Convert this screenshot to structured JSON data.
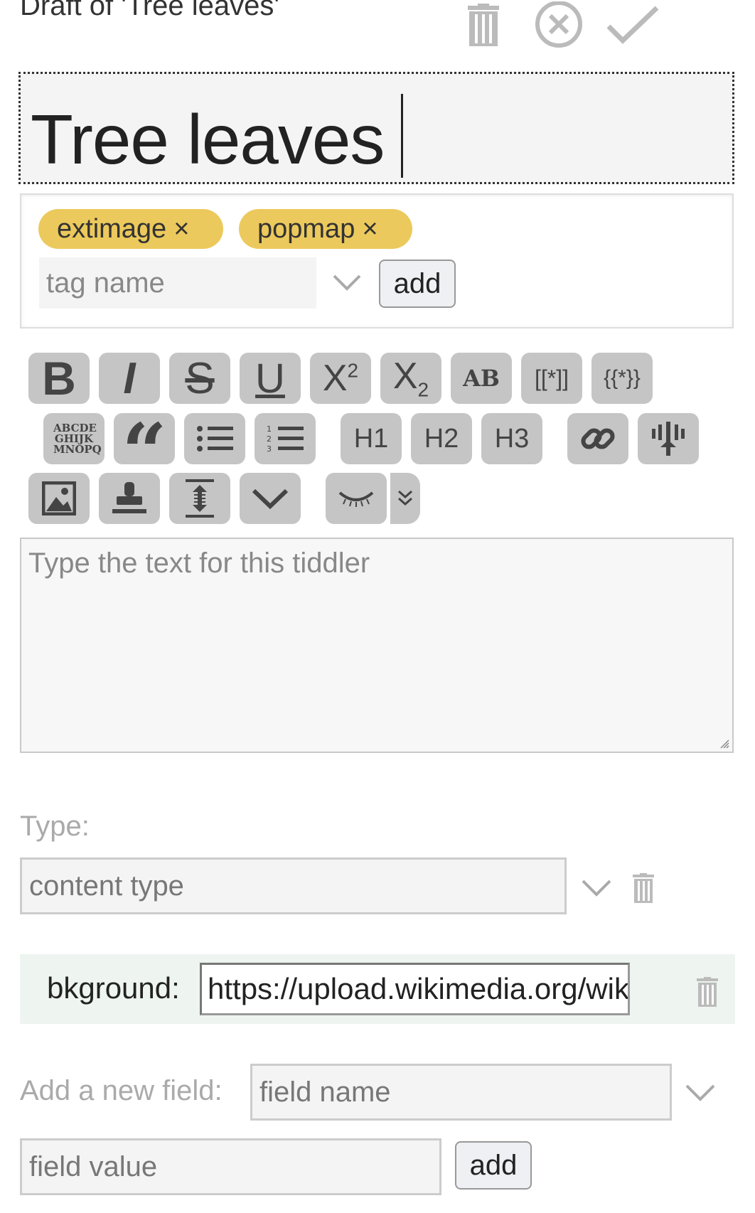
{
  "header": {
    "draft_title": "Draft of 'Tree leaves'",
    "delete_icon": "trash-icon",
    "cancel_icon": "circle-x-icon",
    "done_icon": "checkmark-icon"
  },
  "title": {
    "value": "Tree leaves"
  },
  "tags": {
    "items": [
      {
        "label": "extimage",
        "remove": "×"
      },
      {
        "label": "popmap",
        "remove": "×"
      }
    ],
    "input_placeholder": "tag name",
    "add_label": "add",
    "tag_color": "#ecc95c"
  },
  "toolbar": {
    "buttons": [
      {
        "label": "B",
        "name": "bold"
      },
      {
        "label": "I",
        "name": "italic"
      },
      {
        "label": "S",
        "name": "strikethrough"
      },
      {
        "label": "U",
        "name": "underline"
      },
      {
        "label": "X",
        "sup": "2",
        "name": "superscript"
      },
      {
        "label": "X",
        "sub": "2",
        "name": "subscript"
      },
      {
        "label": "AB",
        "name": "mono-line"
      },
      {
        "label": "[[*]]",
        "name": "wikilink"
      },
      {
        "label": "{{*}}",
        "name": "transclude"
      },
      {
        "label": "ABCDE GHIJK MNOPQ",
        "name": "monospace-block"
      },
      {
        "label": "“",
        "name": "quote"
      },
      {
        "label": "bullet list",
        "name": "list-bullet"
      },
      {
        "label": "number list",
        "name": "list-number"
      },
      {
        "label": "H1",
        "name": "heading-1"
      },
      {
        "label": "H2",
        "name": "heading-2"
      },
      {
        "label": "H3",
        "name": "heading-3"
      },
      {
        "label": "link",
        "name": "link"
      },
      {
        "label": "excise",
        "name": "excise"
      },
      {
        "label": "image",
        "name": "picture"
      },
      {
        "label": "stamp",
        "name": "stamp"
      },
      {
        "label": "size",
        "name": "editor-height"
      },
      {
        "label": "more",
        "name": "more"
      },
      {
        "label": "preview",
        "name": "preview"
      },
      {
        "label": "preview type",
        "name": "preview-type"
      }
    ]
  },
  "body": {
    "placeholder": "Type the text for this tiddler"
  },
  "type": {
    "label": "Type:",
    "placeholder": "content type"
  },
  "fields": [
    {
      "name": "bkground:",
      "value": "https://upload.wikimedia.org/wikipedia"
    }
  ],
  "new_field": {
    "label": "Add a new field:",
    "name_placeholder": "field name",
    "value_placeholder": "field value",
    "add_label": "add"
  }
}
